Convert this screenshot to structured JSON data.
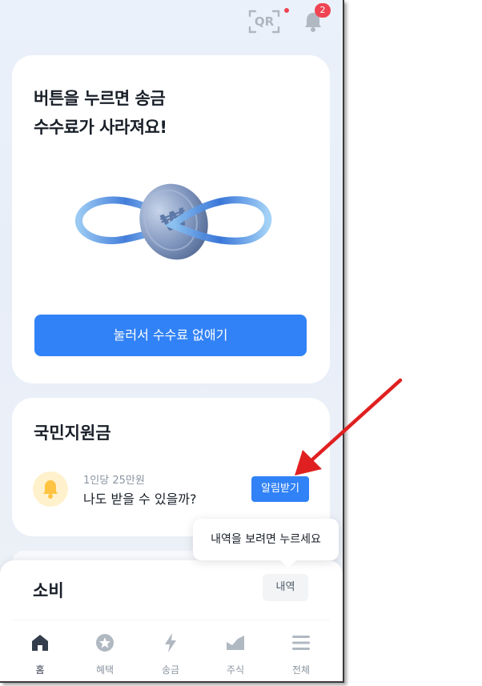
{
  "header": {
    "qr_label": "QR",
    "notification_count": "2"
  },
  "promo": {
    "title_line1": "버튼을 누르면 송금",
    "title_line2": "수수료가 사라져요!",
    "button_label": "눌러서 수수료 없애기"
  },
  "support": {
    "title": "국민지원금",
    "subtitle": "1인당 25만원",
    "main_text": "나도 받을 수 있을까?",
    "button_label": "알림받기"
  },
  "tooltip": {
    "text": "내역을 보려면 누르세요"
  },
  "spending": {
    "title": "소비",
    "button_label": "내역"
  },
  "tabs": [
    {
      "label": "홈",
      "icon": "home-icon",
      "active": true
    },
    {
      "label": "혜택",
      "icon": "benefit-icon",
      "active": false
    },
    {
      "label": "송금",
      "icon": "lightning-icon",
      "active": false
    },
    {
      "label": "주식",
      "icon": "chart-icon",
      "active": false
    },
    {
      "label": "전체",
      "icon": "menu-icon",
      "active": false
    }
  ],
  "colors": {
    "accent": "#3182f6",
    "badge": "#f04452",
    "annotation_arrow": "#e02020"
  }
}
